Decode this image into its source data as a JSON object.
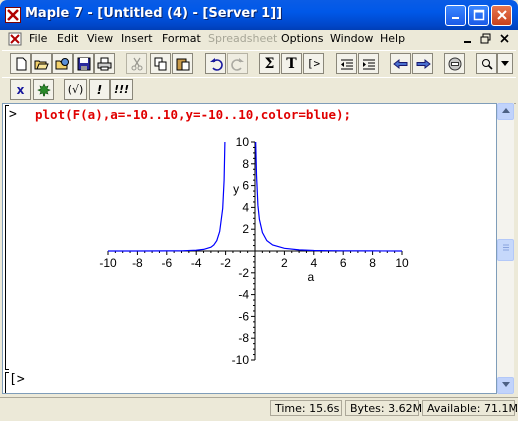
{
  "window": {
    "title": "Maple 7  - [Untitled (4) - [Server 1]]"
  },
  "menu": {
    "items": [
      {
        "label": "File",
        "enabled": true
      },
      {
        "label": "Edit",
        "enabled": true
      },
      {
        "label": "View",
        "enabled": true
      },
      {
        "label": "Insert",
        "enabled": true
      },
      {
        "label": "Format",
        "enabled": true
      },
      {
        "label": "Spreadsheet",
        "enabled": false
      },
      {
        "label": "Options",
        "enabled": true
      },
      {
        "label": "Window",
        "enabled": true
      },
      {
        "label": "Help",
        "enabled": true
      }
    ]
  },
  "toolbar": {
    "sigma_glyph": "Σ",
    "text_glyph": "T",
    "maple_input_glyph": "[>"
  },
  "context_bar": {
    "delayed_eval_label": "(√)",
    "exclaim_label": "!",
    "exec_all_label": "!!!",
    "x_label": "x"
  },
  "worksheet": {
    "prompt": ">",
    "input": "plot(F(a),a=-10..10,y=-10..10,color=blue);",
    "prompt2": "[>"
  },
  "chart_data": {
    "type": "line",
    "xlabel": "a",
    "ylabel": "y",
    "xlim": [
      -10,
      10
    ],
    "ylim": [
      -10,
      10
    ],
    "x_ticks": [
      -10,
      -8,
      -6,
      -4,
      -2,
      2,
      4,
      6,
      8,
      10
    ],
    "y_ticks": [
      -10,
      -8,
      -6,
      -4,
      -2,
      2,
      4,
      6,
      8,
      10
    ],
    "series": [
      {
        "color": "#0000ff",
        "segments": [
          {
            "x": [
              -10,
              -8,
              -6,
              -5,
              -4,
              -3.5,
              -3,
              -2.8,
              -2.6,
              -2.4,
              -2.2,
              -2.1,
              -2.05
            ],
            "y": [
              0.0,
              0.002,
              0.01,
              0.02,
              0.07,
              0.15,
              0.35,
              0.55,
              0.95,
              1.8,
              3.9,
              6.5,
              10
            ]
          },
          {
            "x": [
              0.05,
              0.1,
              0.2,
              0.3,
              0.5,
              0.8,
              1.2,
              2,
              3,
              4,
              5,
              6,
              8,
              10
            ],
            "y": [
              10,
              7.0,
              4.2,
              2.9,
              1.7,
              0.95,
              0.55,
              0.25,
              0.1,
              0.05,
              0.03,
              0.02,
              0.007,
              0.0
            ]
          }
        ]
      }
    ]
  },
  "status": {
    "time": "Time: 15.6s",
    "bytes": "Bytes: 3.62M",
    "available": "Available: 71.1M"
  },
  "colors": {
    "input_text": "#e00000",
    "plot_line": "#0000ff"
  }
}
